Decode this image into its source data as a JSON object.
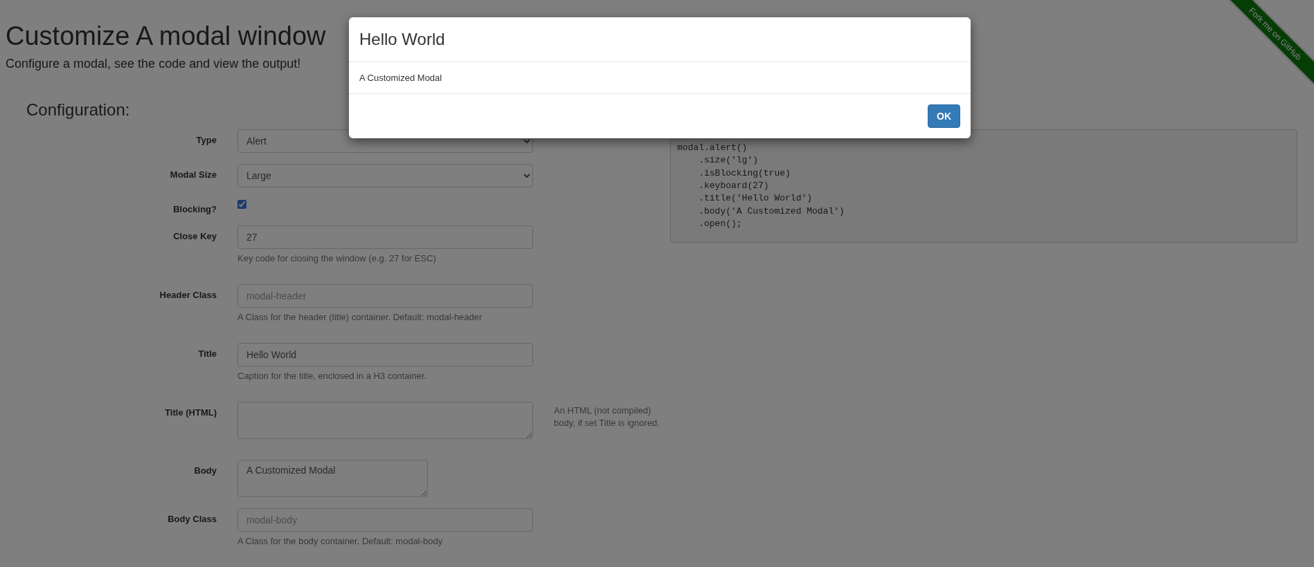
{
  "page": {
    "title": "Customize A modal window",
    "subtitle": "Configure a modal, see the code and view the output!"
  },
  "ribbon": {
    "label": "Fork me on GitHub"
  },
  "configuration": {
    "heading": "Configuration:",
    "fields": [
      {
        "kind": "select",
        "label": "Type",
        "value": "Alert"
      },
      {
        "kind": "select",
        "label": "Modal Size",
        "value": "Large"
      },
      {
        "kind": "checkbox",
        "label": "Blocking?",
        "checked": true
      },
      {
        "kind": "input",
        "label": "Close Key",
        "value": "27",
        "help": "Key code for closing the window (e.g. 27 for ESC)"
      },
      {
        "kind": "input",
        "label": "Header Class",
        "placeholder": "modal-header",
        "help": "A Class for the header (title) container. Default: modal-header"
      },
      {
        "kind": "input",
        "label": "Title",
        "value": "Hello World",
        "help": "Caption for the title, enclosed in a H3 container."
      },
      {
        "kind": "textarea",
        "label": "Title (HTML)",
        "help": "An HTML (not compiled) body, if set Title is ignored."
      },
      {
        "kind": "textarea",
        "label": "Body",
        "value": "A Customized Modal"
      },
      {
        "kind": "input",
        "label": "Body Class",
        "placeholder": "modal-body",
        "help": "A Class for the body container. Default: modal-body"
      }
    ]
  },
  "code": {
    "lines": [
      "modal.alert()",
      "    .size('lg')",
      "    .isBlocking(true)",
      "    .keyboard(27)",
      "    .title('Hello World')",
      "    .body('A Customized Modal')",
      "    .open();"
    ]
  },
  "modal": {
    "title": "Hello World",
    "body": "A Customized Modal",
    "buttons": [
      "OK"
    ]
  }
}
